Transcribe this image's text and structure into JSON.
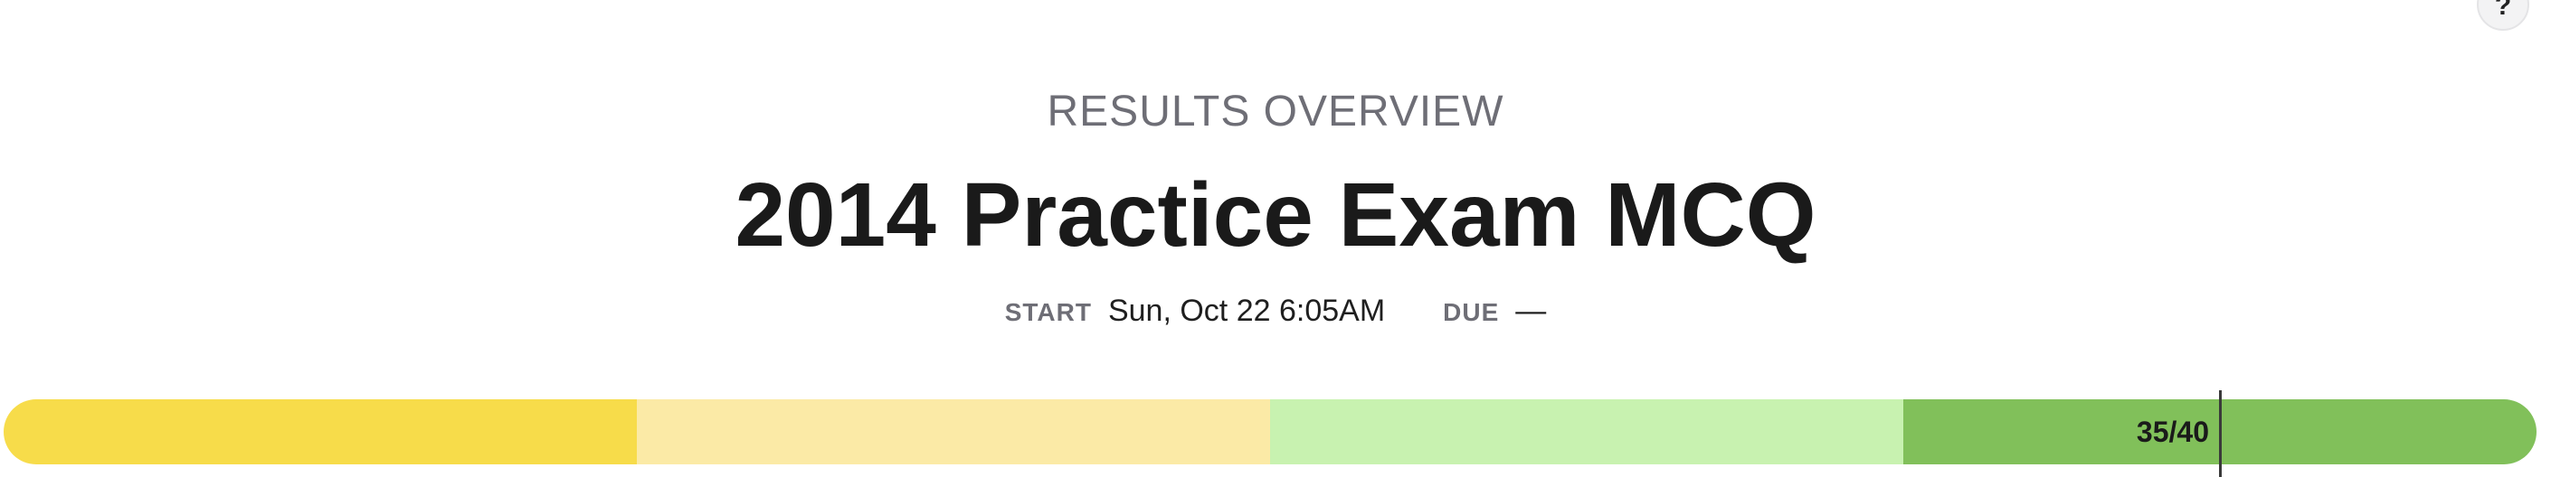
{
  "help_button": {
    "label": "?"
  },
  "header": {
    "eyebrow": "RESULTS OVERVIEW",
    "title": "2014 Practice Exam MCQ"
  },
  "meta": {
    "start_label": "START",
    "start_value": "Sun, Oct 22 6:05AM",
    "due_label": "DUE",
    "due_value": "—"
  },
  "score": {
    "label": "35/40",
    "correct": 35,
    "total": 40,
    "segments": [
      {
        "name": "segment-1",
        "color": "#f7dc4a"
      },
      {
        "name": "segment-2",
        "color": "#fbeaa6"
      },
      {
        "name": "segment-3",
        "color": "#c8f2b0"
      },
      {
        "name": "segment-4",
        "color": "#81c05a"
      }
    ]
  }
}
